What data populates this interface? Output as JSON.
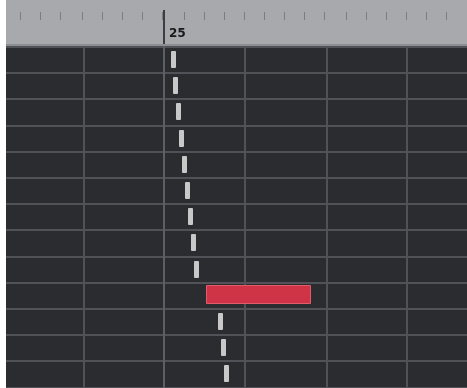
{
  "ruler": {
    "bar_label": "25"
  },
  "colors": {
    "background": "#2a2c30",
    "ruler": "#a7a9ad",
    "grid_line": "#505257",
    "note": "#c8c8c8",
    "selected_note": "#cf3446"
  },
  "notes": [
    {
      "row": 0,
      "selected": false
    },
    {
      "row": 1,
      "selected": false
    },
    {
      "row": 2,
      "selected": false
    },
    {
      "row": 3,
      "selected": false
    },
    {
      "row": 4,
      "selected": false
    },
    {
      "row": 5,
      "selected": false
    },
    {
      "row": 6,
      "selected": false
    },
    {
      "row": 7,
      "selected": false
    },
    {
      "row": 8,
      "selected": false
    },
    {
      "row": 9,
      "selected": true
    },
    {
      "row": 10,
      "selected": false
    },
    {
      "row": 11,
      "selected": false
    },
    {
      "row": 12,
      "selected": false
    }
  ]
}
